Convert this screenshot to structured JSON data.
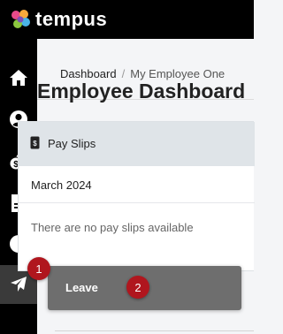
{
  "app": {
    "name": "tempus"
  },
  "breadcrumb": {
    "items": [
      "Dashboard",
      "My Employee One"
    ],
    "separator": "/"
  },
  "page": {
    "title": "Employee Dashboard"
  },
  "payslips": {
    "title": "Pay Slips",
    "month": "March 2024",
    "empty_message": "There are no pay slips available"
  },
  "sidebar": {
    "items": [
      {
        "icon": "home-icon",
        "active": false
      },
      {
        "icon": "user-circle-icon",
        "active": false
      },
      {
        "icon": "coins-icon",
        "active": false
      },
      {
        "icon": "document-icon",
        "active": false
      },
      {
        "icon": "clock-icon",
        "active": false
      },
      {
        "icon": "plane-icon",
        "active": true
      }
    ]
  },
  "tooltip": {
    "label": "Leave"
  },
  "badges": [
    "1",
    "2"
  ],
  "colors": {
    "topbar": "#000000",
    "sidebar": "#000000",
    "active_item": "#3a3a3a",
    "badge": "#b0161e",
    "tooltip": "#6e6e6e",
    "card_header": "#dfe4e8"
  }
}
